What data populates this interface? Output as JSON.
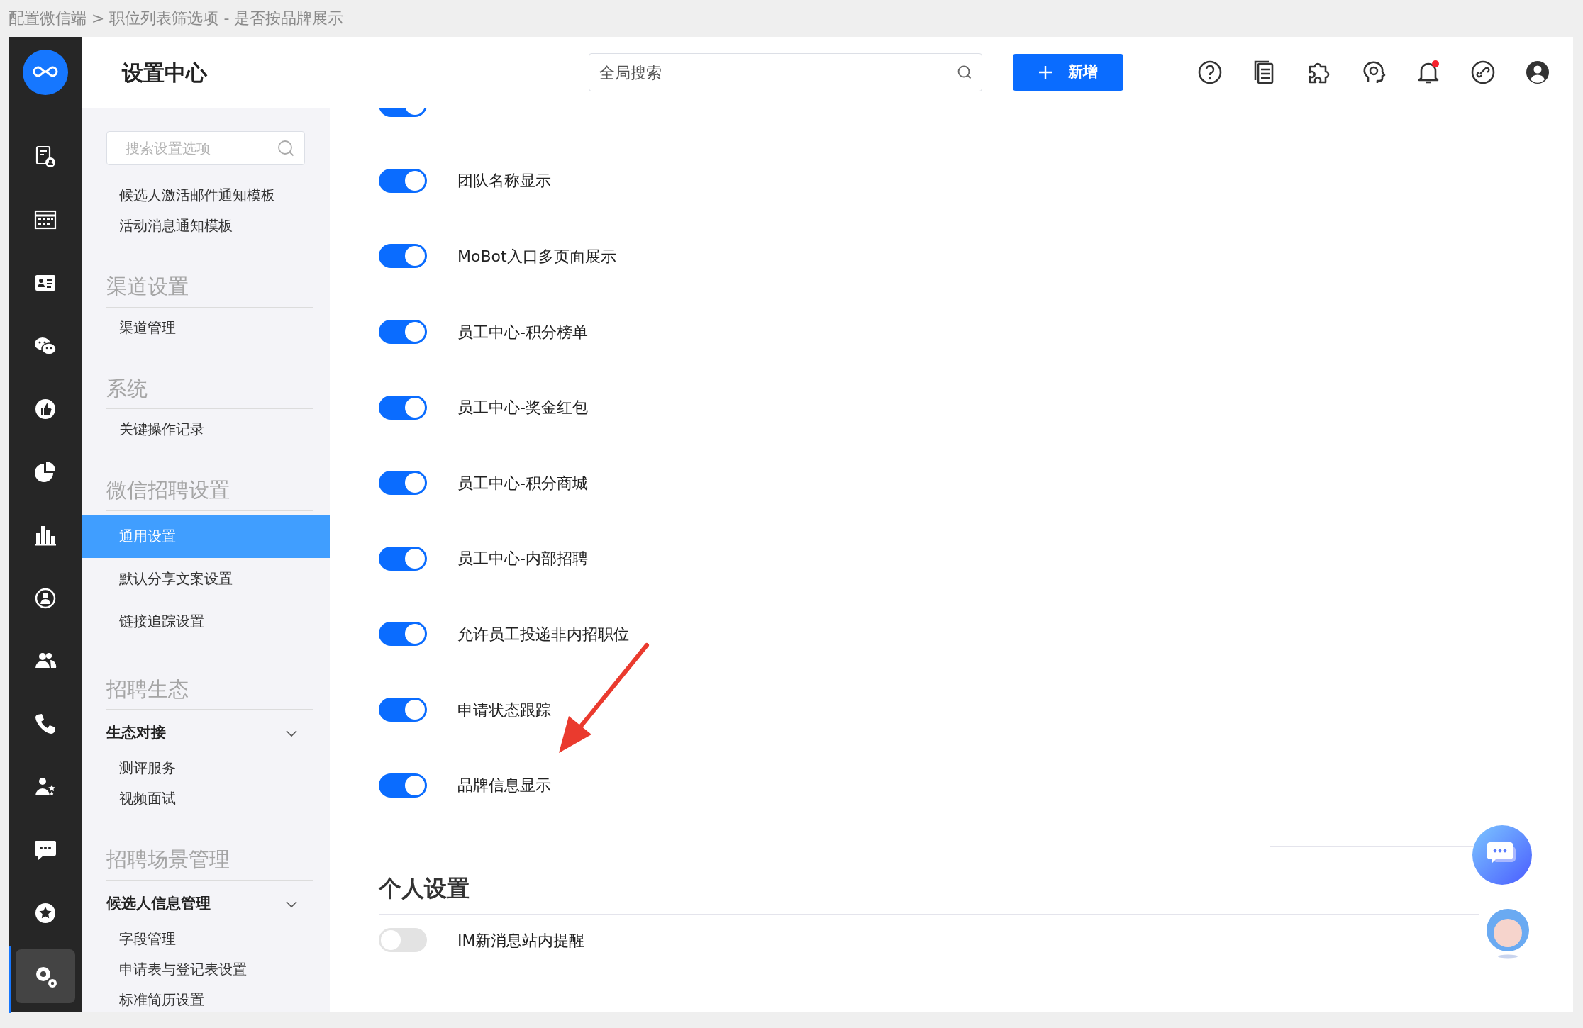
{
  "caption": "配置微信端 > 职位列表筛选项 - 是否按品牌展示",
  "sidebar": {
    "items": [
      {
        "selected": false
      },
      {
        "selected": false
      },
      {
        "selected": false
      },
      {
        "selected": false
      },
      {
        "selected": false
      },
      {
        "selected": false
      },
      {
        "selected": false
      },
      {
        "selected": false
      },
      {
        "selected": false
      },
      {
        "selected": false
      },
      {
        "selected": false
      },
      {
        "selected": false
      },
      {
        "selected": false
      },
      {
        "selected": true
      }
    ]
  },
  "header": {
    "title": "设置中心",
    "search": {
      "placeholder": "全局搜索"
    },
    "new_button": "新增"
  },
  "nav": {
    "search": {
      "placeholder": "搜索设置选项"
    },
    "items": [
      {
        "kind": "sublink",
        "label": "候选人激活邮件通知模板",
        "selected": false
      },
      {
        "kind": "sublink",
        "label": "活动消息通知模板",
        "selected": false
      },
      {
        "kind": "heading",
        "label": "渠道设置"
      },
      {
        "kind": "sublink",
        "label": "渠道管理",
        "selected": false
      },
      {
        "kind": "heading",
        "label": "系统"
      },
      {
        "kind": "sublink",
        "label": "关键操作记录",
        "selected": false
      },
      {
        "kind": "heading",
        "label": "微信招聘设置"
      },
      {
        "kind": "link",
        "label": "通用设置",
        "selected": true
      },
      {
        "kind": "link",
        "label": "默认分享文案设置",
        "selected": false
      },
      {
        "kind": "link",
        "label": "链接追踪设置",
        "selected": false
      },
      {
        "kind": "heading",
        "label": "招聘生态"
      },
      {
        "kind": "group",
        "label": "生态对接",
        "expanded": true
      },
      {
        "kind": "sublink",
        "label": "测评服务",
        "selected": false
      },
      {
        "kind": "sublink",
        "label": "视频面试",
        "selected": false
      },
      {
        "kind": "heading",
        "label": "招聘场景管理"
      },
      {
        "kind": "group",
        "label": "候选人信息管理",
        "expanded": true
      },
      {
        "kind": "sublink",
        "label": "字段管理",
        "selected": false
      },
      {
        "kind": "sublink",
        "label": "申请表与登记表设置",
        "selected": false
      },
      {
        "kind": "sublink",
        "label": "标准简历设置",
        "selected": false
      }
    ]
  },
  "settings": [
    {
      "on": true
    },
    {
      "label": "团队名称显示",
      "on": true
    },
    {
      "label": "MoBot入口多页面展示",
      "on": true
    },
    {
      "label": "员工中心-积分榜单",
      "on": true
    },
    {
      "label": "员工中心-奖金红包",
      "on": true
    },
    {
      "label": "员工中心-积分商城",
      "on": true
    },
    {
      "label": "员工中心-内部招聘",
      "on": true
    },
    {
      "label": "允许员工投递非内招职位",
      "on": true
    },
    {
      "label": "申请状态跟踪",
      "on": true
    },
    {
      "label": "品牌信息显示",
      "on": true
    }
  ],
  "personal": {
    "title": "个人设置",
    "settings": [
      {
        "label": "IM新消息站内提醒",
        "on": false
      }
    ]
  }
}
